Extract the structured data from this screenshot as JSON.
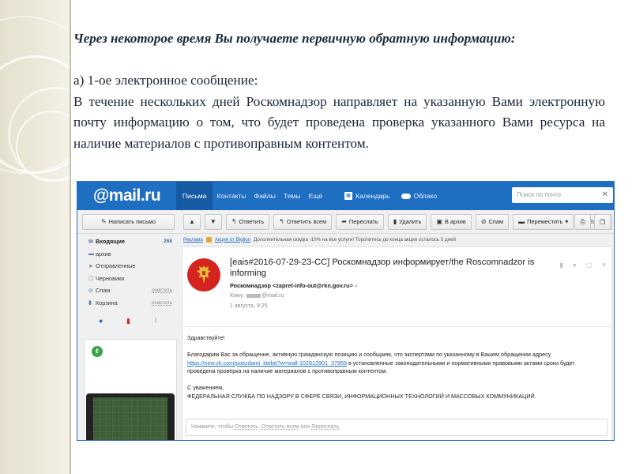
{
  "slide": {
    "heading": "Через некоторое время Вы получаете первичную обратную информацию:",
    "subheading": "а) 1-ое электронное сообщение:",
    "paragraph": "В течение нескольких дней Роскомнадзор направляет на указанную Вами электронную почту информацию о том, что будет проведена проверка указанного Вами ресурса на наличие материалов с противоправным контентом."
  },
  "mail": {
    "logo": "@mail.ru",
    "nav": [
      "Письма",
      "Контакты",
      "Файлы",
      "Темы",
      "Ещё"
    ],
    "calendar_label": "Календарь",
    "cloud_label": "Облако",
    "search_placeholder": "Поиск по почте",
    "compose_label": "Написать письмо",
    "toolbar": {
      "reply": "Ответить",
      "reply_all": "Ответить всем",
      "forward": "Переслать",
      "delete": "Удалить",
      "archive": "В архив",
      "spam": "Спам",
      "move": "Переместить",
      "more": "Ещё"
    },
    "folders": [
      {
        "label": "Входящие",
        "count": "268",
        "icon": "inbox-icon"
      },
      {
        "label": "архив",
        "icon": "folder-icon"
      },
      {
        "label": "Отправленные",
        "icon": "sent-icon"
      },
      {
        "label": "Черновики",
        "icon": "draft-icon"
      },
      {
        "label": "Спам",
        "action": "очистить",
        "icon": "spam-icon"
      },
      {
        "label": "Корзина",
        "action": "очистить",
        "icon": "trash-icon"
      }
    ],
    "ad_line": {
      "tag": "Реклама",
      "link": "Акция от Biglion",
      "text": "Дополнительная скидка -10% на все услуги! Торопитесь до конца акции осталось 5 дней"
    },
    "letter": {
      "subject": "[eais#2016-07-29-23-CC] Роскомнадзор информирует/the Roscomnadzor is informing",
      "sender": "Роскомнадзор <zapret-info-out@rkn.gov.ru>",
      "to_label": "Кому:",
      "to_domain": "@mail.ru",
      "date": "1 августа, 9:25",
      "greeting": "Здравствуйте!",
      "body_before_link": "Благодарим Вас за обращение, активную гражданскую позицию и сообщаем, что экспертами по указанному в Вашем обращении адресу",
      "link": "https://new.vk.com/poezdami_ktebe?w=wall-102812901_37959",
      "body_after_link": "в установленные законодательными и нормативными правовыми актами сроки будет проведена проверка на наличие материалов с противоправным контентом.",
      "closing": "С уважением,",
      "signature": "ФЕДЕРАЛЬНАЯ СЛУЖБА ПО НАДЗОРУ В СФЕРЕ СВЯЗИ, ИНФОРМАЦИОННЫХ ТЕХНОЛОГИЙ И МАССОВЫХ КОММУНИКАЦИЙ.",
      "reply_prefix": "Нажмите, чтобы",
      "reply_action": "Ответить",
      "reply_mid": "Ответить всем",
      "reply_or": "или",
      "reply_forward": "Переслать"
    }
  },
  "colors": {
    "mail_blue": "#1e6ec2",
    "seal_red": "#d5241f",
    "heading": "#1c2a3a"
  }
}
